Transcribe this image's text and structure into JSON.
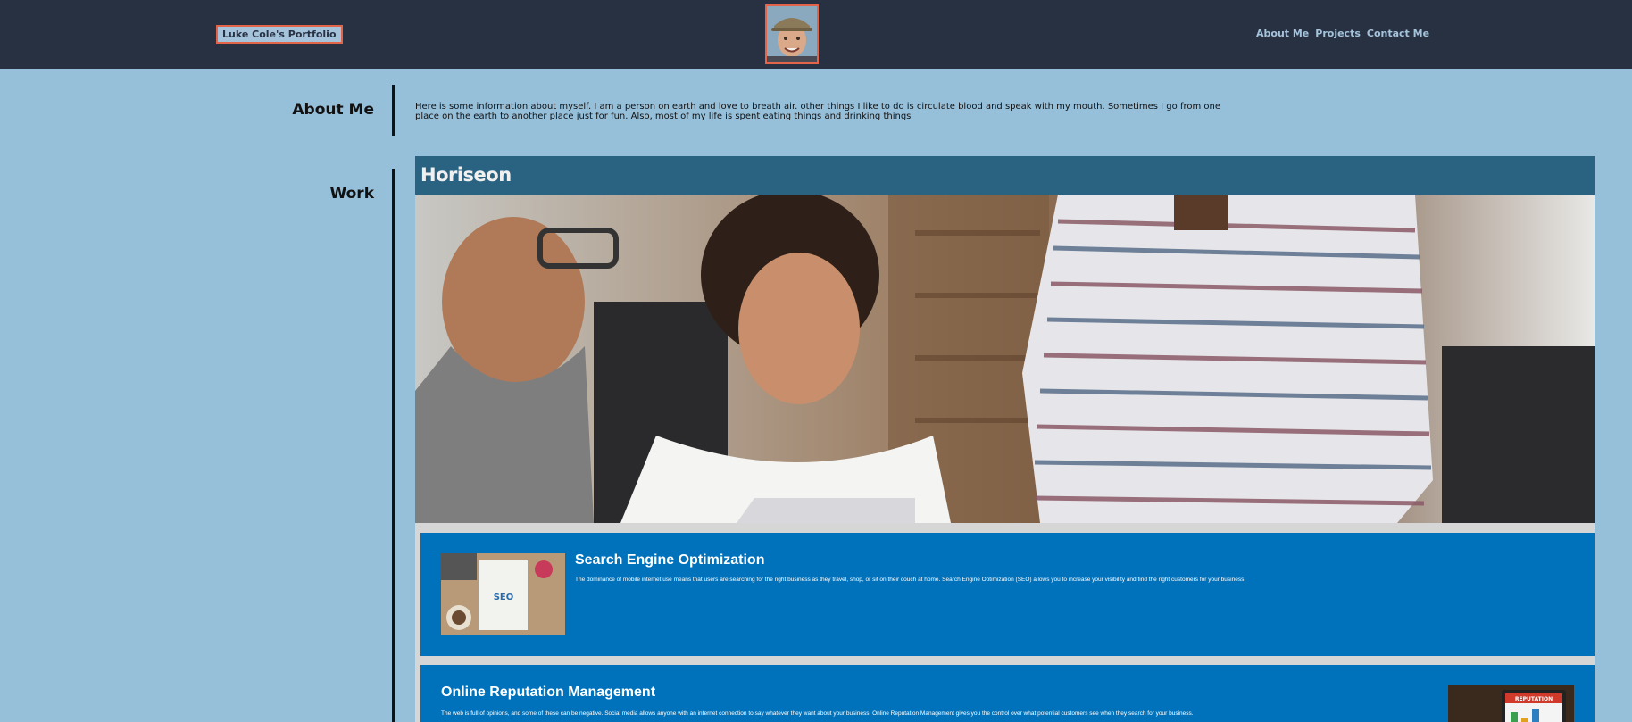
{
  "header": {
    "brand": "Luke Cole's Portfolio",
    "nav": [
      "About Me",
      "Projects",
      "Contact Me"
    ]
  },
  "about": {
    "title": "About Me",
    "text": "Here is some information about myself. I am a person on earth and love to breath air. other things I like to do is circulate blood and speak with my mouth. Sometimes I go from one place on the earth to another place just for fun. Also, most of my life is spent eating things and drinking things"
  },
  "work": {
    "title": "Work",
    "project": {
      "logo": "Horiseon",
      "cards": [
        {
          "title": "Search Engine Optimization",
          "text": "The dominance of mobile internet use means that users are searching for the right business as they travel, shop, or sit on their couch at home. Search Engine Optimization (SEO) allows you to increase your visibility and find the right customers for your business.",
          "thumb_label": "SEO"
        },
        {
          "title": "Online Reputation Management",
          "text": "The web is full of opinions, and some of these can be negative. Social media allows anyone with an internet connection to say whatever they want about your business. Online Reputation Management gives you the control over what potential customers see when they search for your business.",
          "thumb_label": "REPUTATION"
        }
      ]
    }
  },
  "colors": {
    "page_bg": "#96bfda",
    "header_bg": "#283142",
    "accent_border": "#e2654a",
    "card_bg": "#0072bb",
    "project_header_bg": "#2a6381"
  }
}
